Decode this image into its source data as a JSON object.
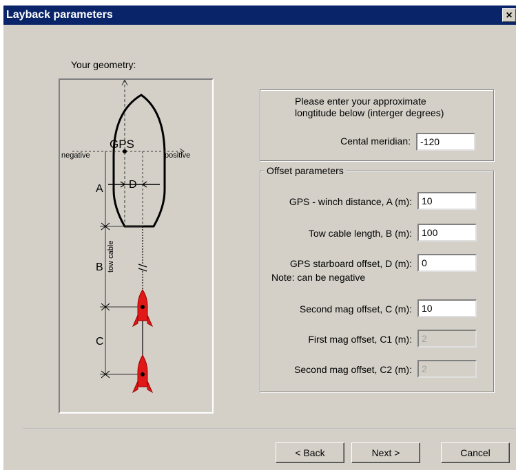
{
  "window": {
    "title": "Layback parameters",
    "close_glyph": "×"
  },
  "geometry": {
    "label": "Your geometry:",
    "labels": {
      "gps": "GPS",
      "negative": "negative",
      "positive": "positive",
      "a": "A",
      "b": "B",
      "c": "C",
      "d": "D",
      "tow_cable": "tow cable"
    }
  },
  "meridian": {
    "instructions_line1": "Please enter your approximate",
    "instructions_line2": "longtitude below (interger degrees)",
    "label": "Cental meridian:",
    "value": "-120"
  },
  "offsets": {
    "title": "Offset parameters",
    "gps_winch_label": "GPS - winch distance, A (m):",
    "gps_winch_value": "10",
    "tow_cable_label": "Tow cable length, B (m):",
    "tow_cable_value": "100",
    "starboard_label": "GPS starboard offset, D (m):",
    "starboard_value": "0",
    "note": "Note: can be negative",
    "second_mag_c_label": "Second mag offset, C (m):",
    "second_mag_c_value": "10",
    "first_mag_c1_label": "First mag offset, C1 (m):",
    "first_mag_c1_value": "2",
    "second_mag_c2_label": "Second mag offset, C2 (m):",
    "second_mag_c2_value": "2"
  },
  "buttons": {
    "back": "< Back",
    "next": "Next >",
    "cancel": "Cancel"
  },
  "colors": {
    "titlebar": "#0a246a",
    "dialog": "#d4d0c8",
    "magnetometer": "#e01818"
  }
}
